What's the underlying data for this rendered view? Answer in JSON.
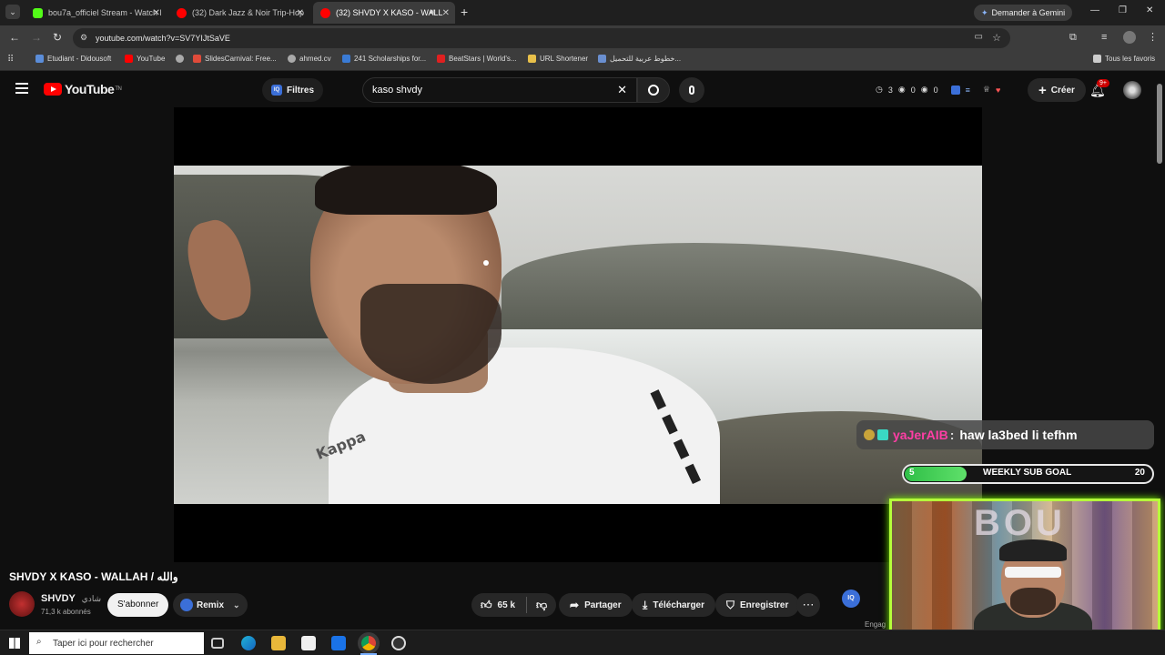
{
  "browser": {
    "tabs": [
      {
        "label": "bou7a_officiel Stream - Watch l",
        "favicon_color": "#53fc18"
      },
      {
        "label": "(32) Dark Jazz & Noir Trip-Hop",
        "favicon_color": "#ff0000"
      },
      {
        "label": "(32) SHVDY X KASO - WALL",
        "favicon_color": "#ff0000"
      }
    ],
    "gemini_label": "Demander à Gemini",
    "url": "youtube.com/watch?v=SV7YIJtSaVE",
    "bookmarks": [
      "Etudiant - Didousoft",
      "YouTube",
      "SlidesCarnival: Free...",
      "ahmed.cv",
      "241 Scholarships for...",
      "BeatStars | World's...",
      "URL Shortener",
      "خطوط عربية للتحميل..."
    ],
    "all_bookmarks": "Tous les favoris"
  },
  "yt": {
    "logo_text": "YouTube",
    "logo_sup": "TN",
    "filters_label": "Filtres",
    "search_value": "kaso shvdy",
    "stats": [
      "3",
      "0",
      "0"
    ],
    "create_label": "Créer",
    "notif_badge": "9+",
    "video_title": "SHVDY X KASO - WALLAH / والله",
    "channel_name": "SHVDY",
    "channel_name_ar": "شادي",
    "subscribers": "71,3 k abonnés",
    "subscribe_label": "S'abonner",
    "remix_label": "Remix",
    "likes": "65 k",
    "share_label": "Partager",
    "download_label": "Télécharger",
    "save_label": "Enregistrer",
    "side_label": "Engag"
  },
  "overlay": {
    "chat_user": "yaJerAIB",
    "chat_message": "haw la3bed li tefhm",
    "goal_current": "5",
    "goal_label": "WEEKLY SUB GOAL",
    "goal_target": "20",
    "goal_progress": 0.25
  },
  "taskbar": {
    "search_placeholder": "Taper ici pour rechercher"
  },
  "colors": {
    "accent_red": "#ff0000",
    "goal_green": "#3ccf4e",
    "cam_border": "#b6ff3b"
  }
}
